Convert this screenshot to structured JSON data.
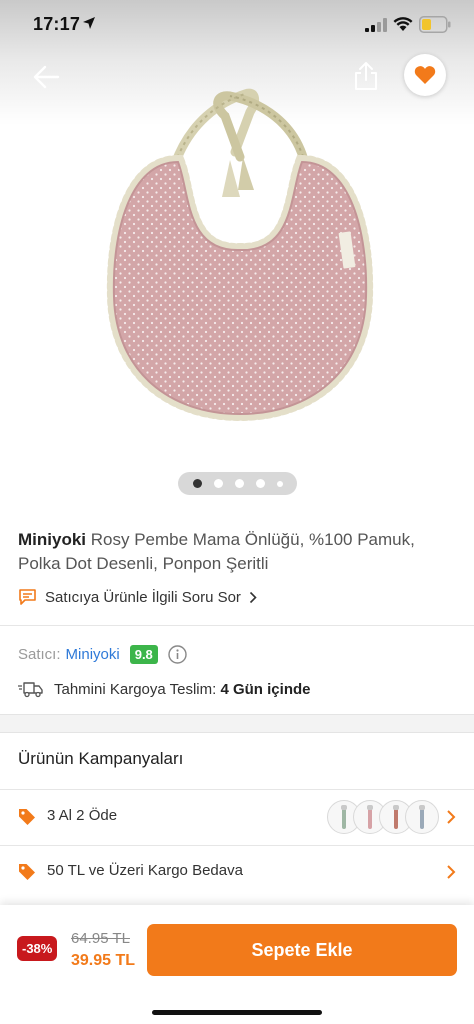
{
  "status_bar": {
    "time": "17:17",
    "icons": [
      "location-arrow-icon",
      "cellular-signal-icon",
      "wifi-icon",
      "battery-icon"
    ]
  },
  "nav": {
    "back_icon": "arrow-left-icon",
    "share_icon": "share-icon",
    "favorite_icon": "heart-icon",
    "favorite_color": "#f27a1a"
  },
  "gallery": {
    "image_count": 5,
    "active_index": 0
  },
  "product": {
    "brand": "Miniyoki",
    "name": "Rosy Pembe Mama Önlüğü, %100 Pamuk, Polka Dot Desenli, Ponpon Şeritli",
    "ask_seller_label": "Satıcıya Ürünle İlgili Soru Sor",
    "ask_seller_icon": "chat-bubble-icon"
  },
  "seller": {
    "label": "Satıcı:",
    "name": "Miniyoki",
    "score": "9.8",
    "score_color": "#3cb54a",
    "info_icon": "info-icon"
  },
  "delivery": {
    "icon": "delivery-truck-icon",
    "label": "Tahmini Kargoya Teslim:",
    "value": "4 Gün içinde"
  },
  "campaigns": {
    "title": "Ürünün Kampanyaları",
    "items": [
      {
        "label": "3 Al 2 Öde",
        "icon": "price-tag-icon",
        "has_thumbnails": true
      },
      {
        "label": "50 TL ve Üzeri Kargo Bedava",
        "icon": "price-tag-icon",
        "has_thumbnails": false
      }
    ]
  },
  "pricing": {
    "discount": "-38%",
    "old_price": "64.95 TL",
    "new_price": "39.95 TL",
    "cart_button": "Sepete Ekle",
    "accent_color": "#f27a1a",
    "discount_color": "#c8191d"
  }
}
